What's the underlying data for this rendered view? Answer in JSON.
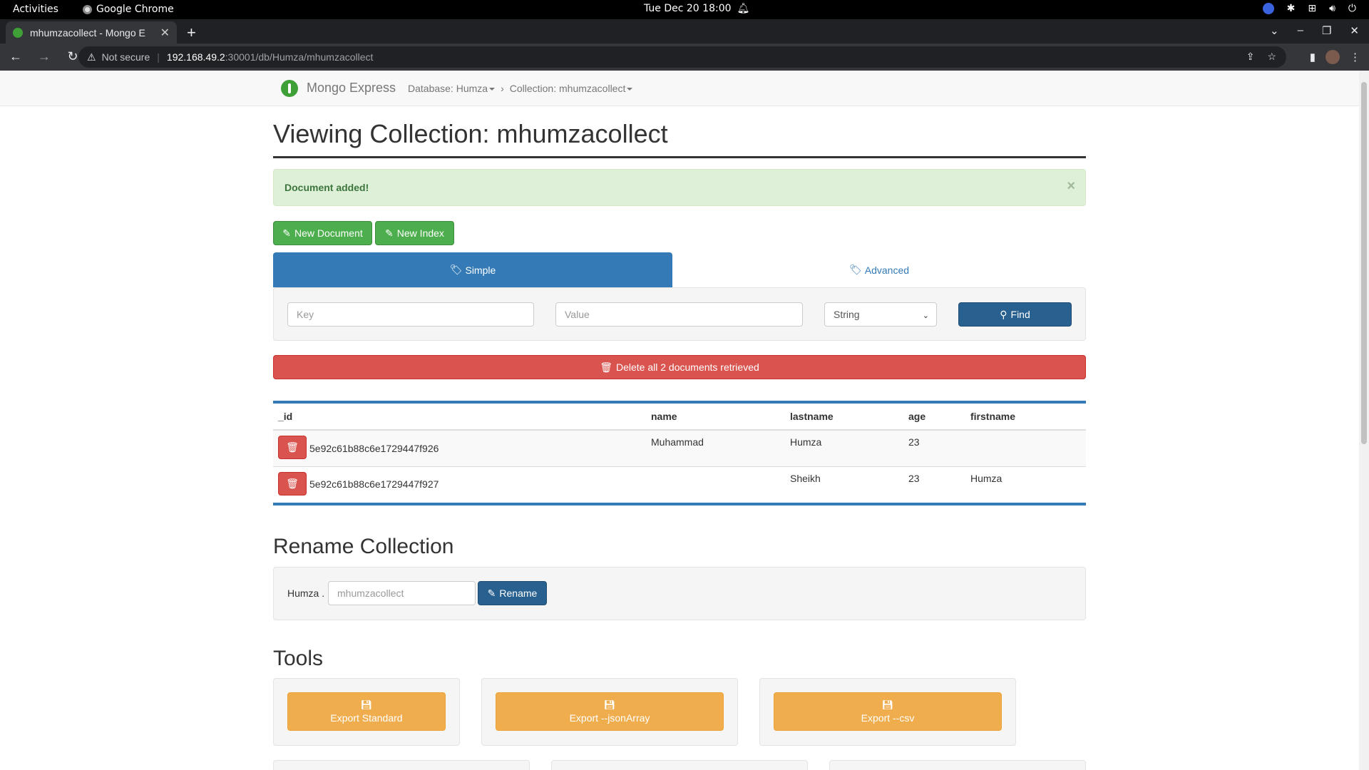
{
  "os": {
    "activities": "Activities",
    "app_name": "Google Chrome",
    "clock": "Tue Dec 20  18:00"
  },
  "browser": {
    "tab_title": "mhumzacollect - Mongo E",
    "security_label": "Not secure",
    "url_host": "192.168.49.2",
    "url_path": ":30001/db/Humza/mhumzacollect"
  },
  "navbar": {
    "brand": "Mongo Express",
    "database_label": "Database: Humza",
    "collection_label": "Collection: mhumzacollect"
  },
  "page": {
    "title": "Viewing Collection: mhumzacollect",
    "alert": "Document added!",
    "new_document": "New Document",
    "new_index": "New Index",
    "tab_simple": "Simple",
    "tab_advanced": "Advanced",
    "key_placeholder": "Key",
    "value_placeholder": "Value",
    "type_selected": "String",
    "find_label": "Find",
    "delete_all_label": "Delete all 2 documents retrieved"
  },
  "table": {
    "headers": [
      "_id",
      "name",
      "lastname",
      "age",
      "firstname"
    ],
    "rows": [
      {
        "_id": "5e92c61b88c6e1729447f926",
        "name": "Muhammad",
        "lastname": "Humza",
        "age": "23",
        "firstname": ""
      },
      {
        "_id": "5e92c61b88c6e1729447f927",
        "name": "",
        "lastname": "Sheikh",
        "age": "23",
        "firstname": "Humza"
      }
    ]
  },
  "rename": {
    "heading": "Rename Collection",
    "db_prefix": "Humza .",
    "input_placeholder": "mhumzacollect",
    "button": "Rename"
  },
  "tools": {
    "heading": "Tools",
    "export_standard": "Export Standard",
    "export_jsonarray": "Export --jsonArray",
    "export_csv": "Export --csv"
  },
  "colors": {
    "primary": "#337ab7",
    "success": "#4cae4c",
    "danger": "#d9534f",
    "warning": "#f0ad4e",
    "alert_bg": "#dff0d8"
  }
}
